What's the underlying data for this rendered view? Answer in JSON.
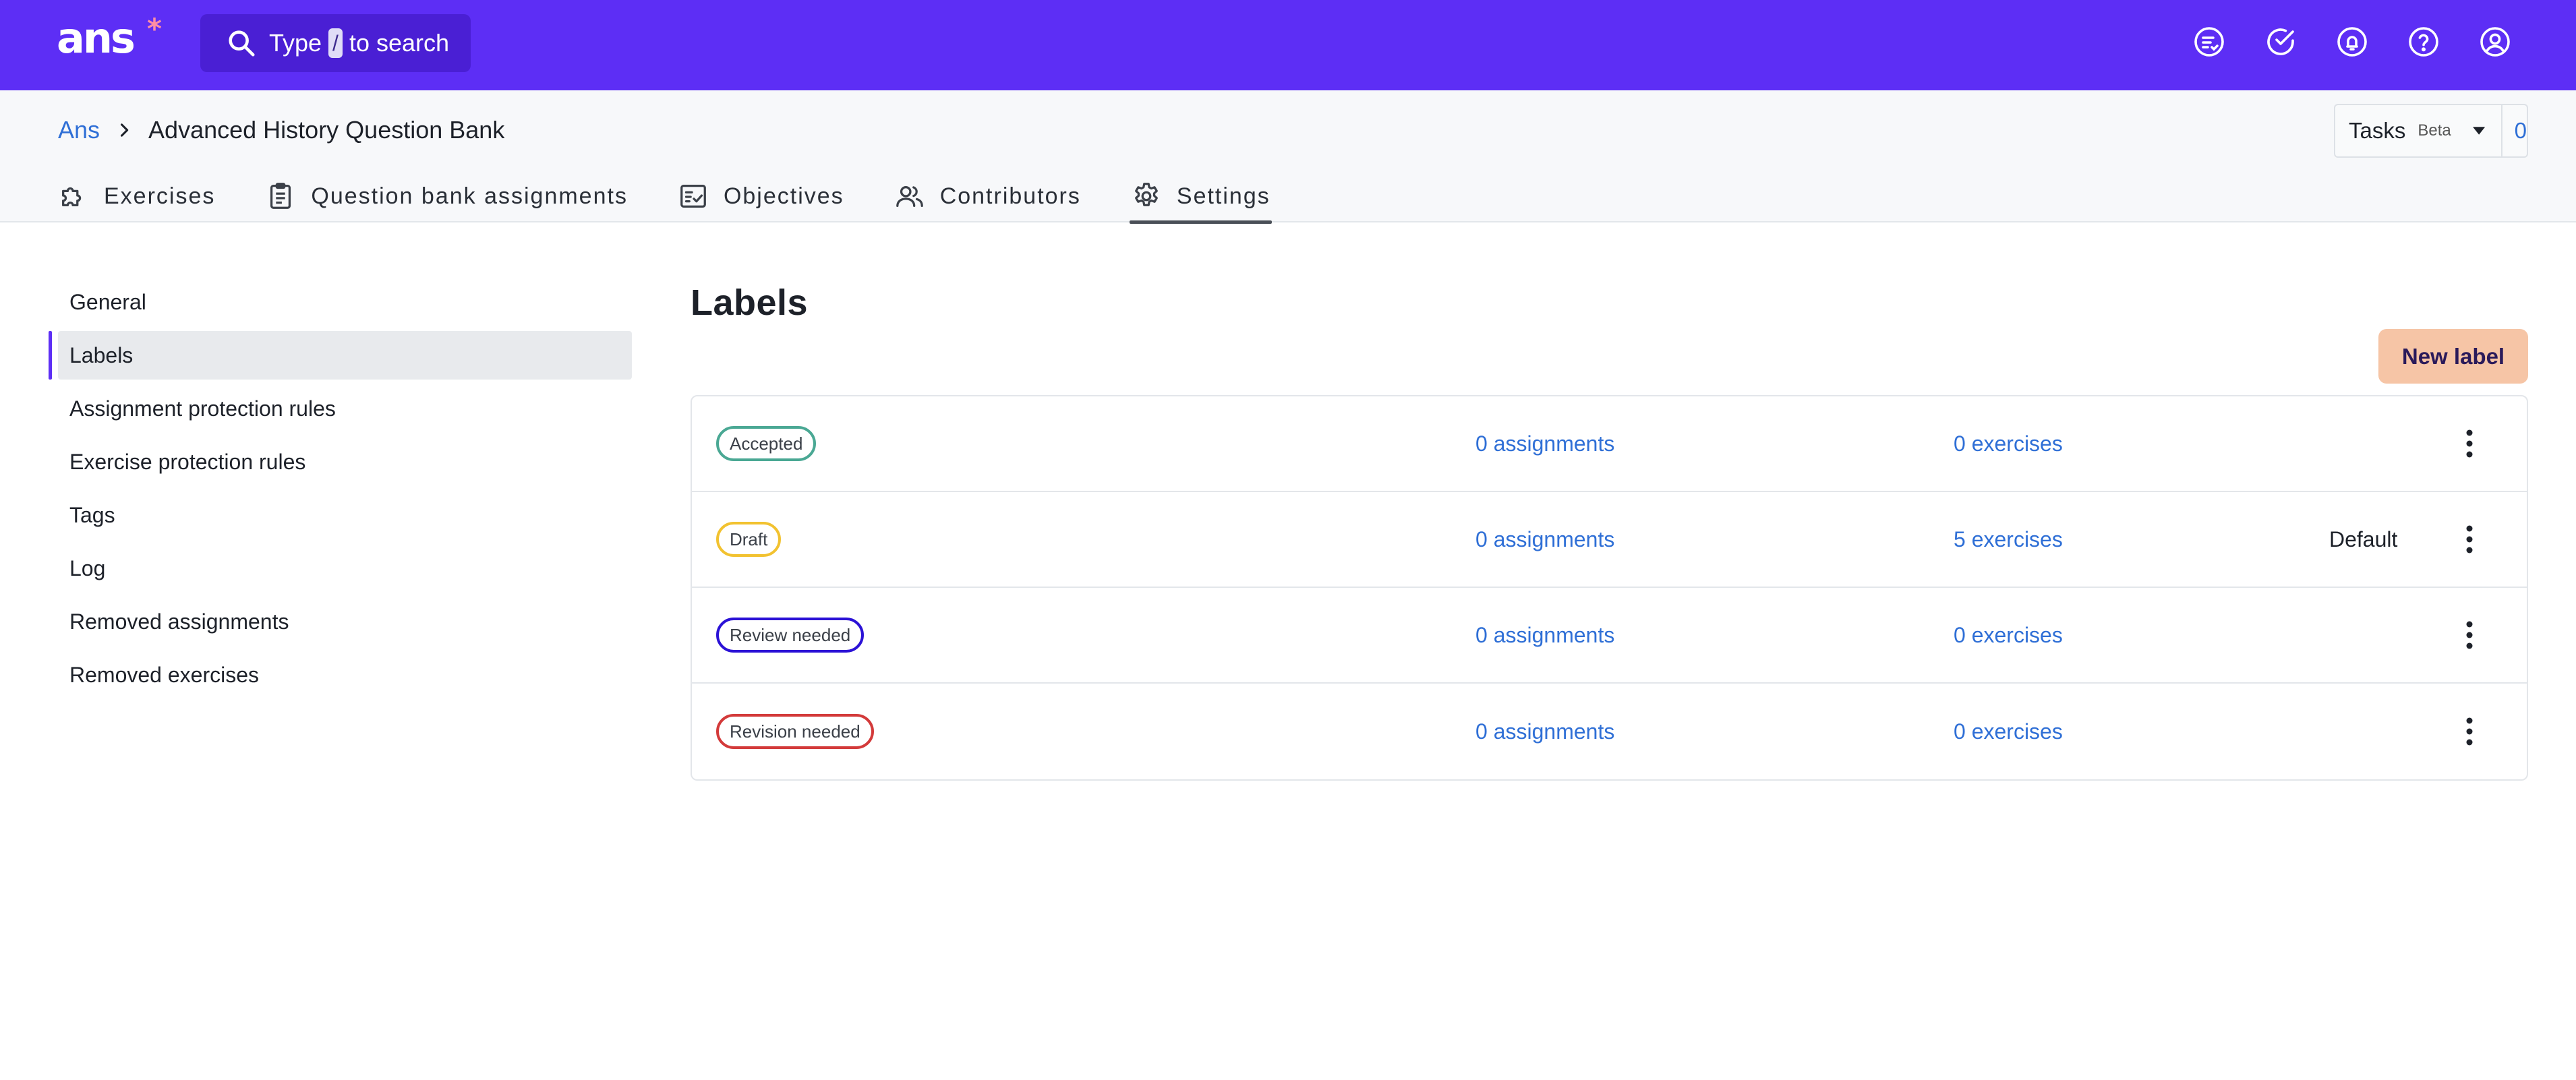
{
  "app": {
    "logo_text": "ans",
    "logo_star": "*",
    "search": {
      "prefix": "Type",
      "key": "/",
      "suffix": "to search"
    },
    "top_icons": [
      "tasks-list-icon",
      "check-circle-icon",
      "bell-icon",
      "help-icon",
      "user-icon"
    ]
  },
  "breadcrumb": {
    "root": "Ans",
    "current": "Advanced History Question Bank"
  },
  "tasks": {
    "label": "Tasks",
    "badge": "Beta",
    "count": "0"
  },
  "tabs": [
    {
      "label": "Exercises",
      "icon": "puzzle-icon"
    },
    {
      "label": "Question bank assignments",
      "icon": "clipboard-icon"
    },
    {
      "label": "Objectives",
      "icon": "checklist-icon"
    },
    {
      "label": "Contributors",
      "icon": "users-icon"
    },
    {
      "label": "Settings",
      "icon": "gear-icon",
      "active": true
    }
  ],
  "sidebar": {
    "items": [
      {
        "label": "General"
      },
      {
        "label": "Labels",
        "active": true
      },
      {
        "label": "Assignment protection rules"
      },
      {
        "label": "Exercise protection rules"
      },
      {
        "label": "Tags"
      },
      {
        "label": "Log"
      },
      {
        "label": "Removed assignments"
      },
      {
        "label": "Removed exercises"
      }
    ]
  },
  "main": {
    "title": "Labels",
    "new_label_button": "New label",
    "labels": [
      {
        "name": "Accepted",
        "color": "#4aa894",
        "assignments": "0 assignments",
        "exercises": "0 exercises",
        "default": ""
      },
      {
        "name": "Draft",
        "color": "#f2c230",
        "assignments": "0 assignments",
        "exercises": "5 exercises",
        "default": "Default"
      },
      {
        "name": "Review needed",
        "color": "#2b12d6",
        "assignments": "0 assignments",
        "exercises": "0 exercises",
        "default": ""
      },
      {
        "name": "Revision needed",
        "color": "#d33a3a",
        "assignments": "0 assignments",
        "exercises": "0 exercises",
        "default": ""
      }
    ]
  },
  "colors": {
    "brand": "#5d2ef5",
    "link": "#2f6fd6",
    "accent_button": "#f6c5a6"
  }
}
